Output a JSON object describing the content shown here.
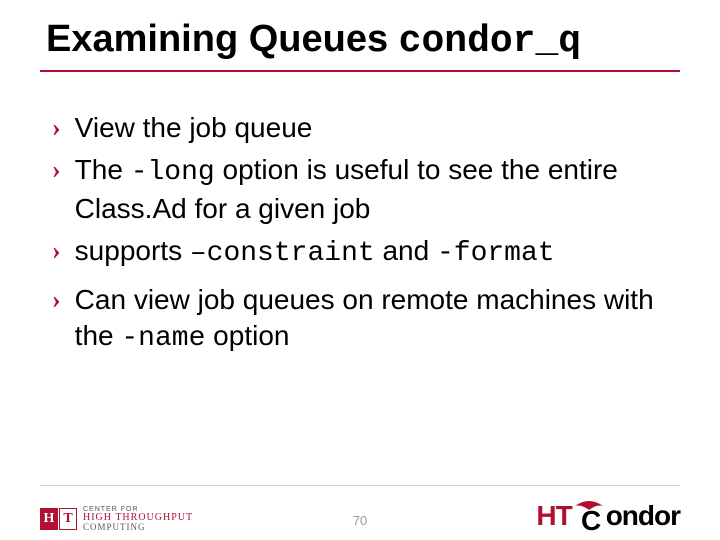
{
  "title": {
    "plain": "Examining Queues ",
    "mono": "condor_q"
  },
  "bullets": {
    "b1": "View the job queue",
    "b2a": "The ",
    "b2b": "-long",
    "b2c": " option is useful to see the entire Class.Ad for a given job",
    "b3a": "supports ",
    "b3b": "–constraint",
    "b3c": " and ",
    "b3d": "-format",
    "b4a": "Can view job queues on remote machines with the ",
    "b4b": "-name",
    "b4c": " option"
  },
  "page_number": "70",
  "left_logo": {
    "h": "H",
    "t": "T",
    "line1": "CENTER FOR",
    "line2": "HIGH THROUGHPUT",
    "line3": "COMPUTING"
  },
  "right_logo": {
    "ht": "HT",
    "c": "C",
    "ondor": "ondor"
  }
}
